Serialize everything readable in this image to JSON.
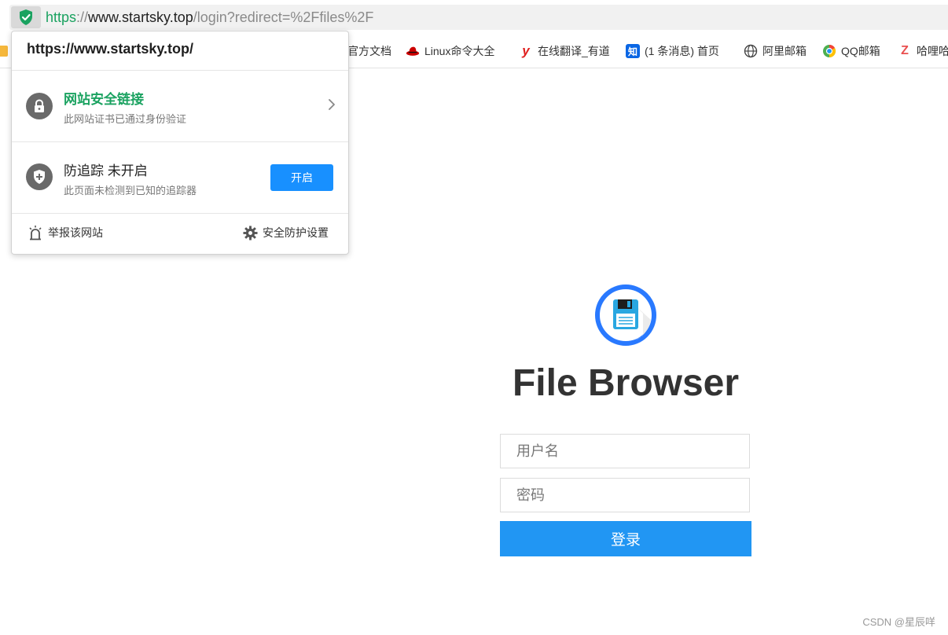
{
  "address_bar": {
    "scheme": "https",
    "separator": "://",
    "host": "www.startsky.top",
    "path": "/login?redirect=%2Ffiles%2F"
  },
  "bookmarks": [
    {
      "label": "官方文档",
      "icon": "doc-icon"
    },
    {
      "label": "Linux命令大全",
      "icon": "redhat-icon"
    },
    {
      "label": "在线翻译_有道",
      "icon": "youdao-icon",
      "glyph": "y"
    },
    {
      "label": "(1 条消息) 首页",
      "icon": "zhihu-icon",
      "glyph": "知"
    },
    {
      "label": "阿里邮箱",
      "icon": "globe-icon"
    },
    {
      "label": "QQ邮箱",
      "icon": "chrome-icon"
    },
    {
      "label": "哈哩哈",
      "icon": "zeta-icon",
      "glyph": "Z"
    }
  ],
  "popup": {
    "site": "https://www.startsky.top/",
    "secure": {
      "title": "网站安全链接",
      "subtitle": "此网站证书已通过身份验证"
    },
    "tracking": {
      "title": "防追踪 未开启",
      "subtitle": "此页面未检测到已知的追踪器",
      "button": "开启"
    },
    "footer": {
      "report": "举报该网站",
      "settings": "安全防护设置"
    }
  },
  "login": {
    "title": "File Browser",
    "username_placeholder": "用户名",
    "password_placeholder": "密码",
    "submit": "登录"
  },
  "watermark": "CSDN @星辰咩",
  "colors": {
    "accent": "#2196f3",
    "secure_green": "#1aa260",
    "popup_button": "#1890ff"
  }
}
